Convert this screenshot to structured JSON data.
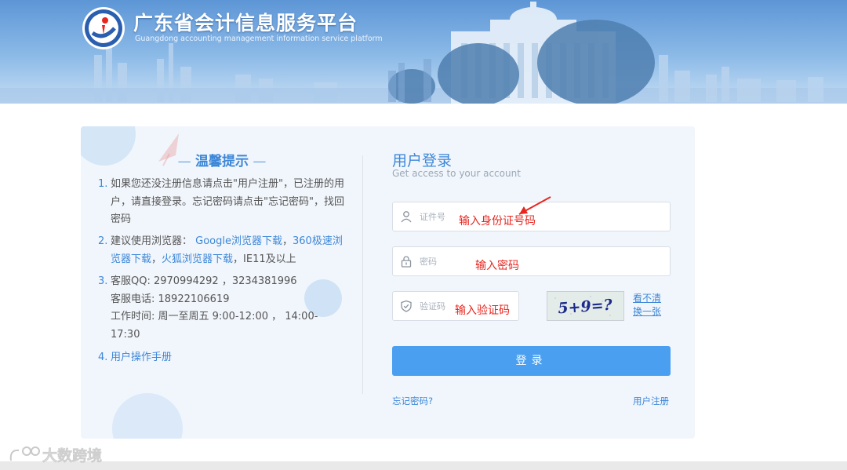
{
  "header": {
    "title": "广东省会计信息服务平台",
    "subtitle": "Guangdong accounting management information service platform",
    "logo_icon": "province-emblem-logo"
  },
  "tips": {
    "title": "温馨提示",
    "items": [
      {
        "num": "1.",
        "text": "如果您还没注册信息请点击\"用户注册\"，已注册的用户，请直接登录。忘记密码请点击\"忘记密码\"，找回密码"
      },
      {
        "num": "2.",
        "prefix": "建议使用浏览器：",
        "link1": "Google浏览器下载",
        "sep1": "，",
        "link2": "360极速浏览器下载",
        "sep2": "，",
        "link3": "火狐浏览器下载",
        "suffix": "，IE11及以上"
      },
      {
        "num": "3.",
        "qq": "客服QQ: 2970994292 ，3234381996",
        "phone": "客服电话: 18922106619",
        "hours": "工作时间: 周一至周五 9:00-12:00 ， 14:00-17:30"
      },
      {
        "num": "4.",
        "link": "用户操作手册"
      }
    ]
  },
  "login": {
    "title": "用户登录",
    "subtitle": "Get access to your account",
    "id_placeholder": "证件号",
    "password_placeholder": "密码",
    "captcha_placeholder": "验证码",
    "captcha_text": "5+9=?",
    "refresh_label": "看不清换一张",
    "button_label": "登录",
    "forgot_label": "忘记密码?",
    "register_label": "用户注册"
  },
  "annotations": {
    "id_hint": "输入身份证号码",
    "password_hint": "输入密码",
    "captcha_hint": "输入验证码"
  },
  "watermark": {
    "text": "大数跨境"
  },
  "colors": {
    "accent": "#3d87d8",
    "button": "#4b9ff0",
    "annotation": "#e8261f",
    "card_bg": "#f1f6fc"
  }
}
